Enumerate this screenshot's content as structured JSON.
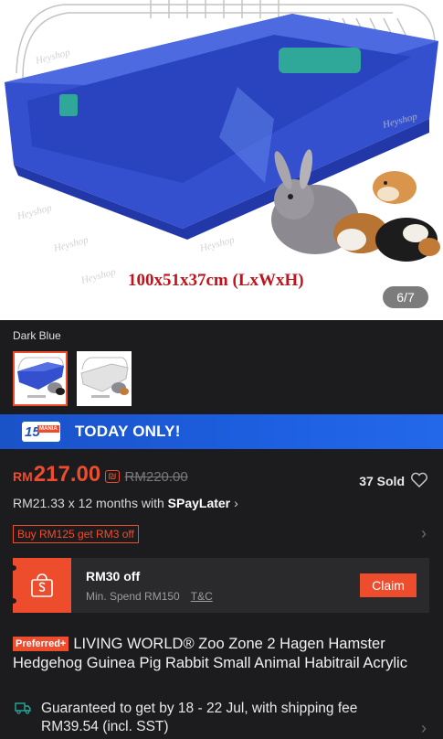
{
  "hero": {
    "dimensions_text": "100x51x37cm (LxWxH)",
    "image_counter": "6/7",
    "watermark": "Heyshop",
    "colors": {
      "cage_base": "#2f4fd0",
      "wire": "#c9c9c9"
    }
  },
  "variation": {
    "label": "Dark Blue",
    "options": [
      {
        "name": "dark-blue",
        "selected": true
      },
      {
        "name": "white",
        "selected": false
      }
    ]
  },
  "banner": {
    "badge_number": "15",
    "badge_word": "MANIA",
    "text": "TODAY ONLY!"
  },
  "price": {
    "currency": "RM",
    "current": "217.00",
    "coin_icon": "coin-icon",
    "original": "RM220.00",
    "sold": "37 Sold",
    "installment_prefix": "RM21.33 x 12 months with ",
    "installment_brand": "SPayLater",
    "installment_chevron": "›"
  },
  "promo": {
    "tag": "Buy RM125 get RM3 off",
    "chevron": "›"
  },
  "voucher": {
    "title": "RM30 off",
    "min_spend": "Min. Spend RM150",
    "tc": "T&C",
    "claim": "Claim"
  },
  "product": {
    "badge": "Preferred+",
    "title": "LIVING WORLD® Zoo Zone 2 Hagen Hamster Hedgehog Guinea Pig Rabbit Small Animal Habitrail Acrylic"
  },
  "shipping": {
    "text": "Guaranteed to get by 18 - 22 Jul, with shipping fee RM39.54 (incl. SST)",
    "chevron": "›"
  },
  "colors": {
    "accent": "#ee4d2d",
    "background": "#1c1c1e",
    "banner": "#1d5fe0"
  }
}
